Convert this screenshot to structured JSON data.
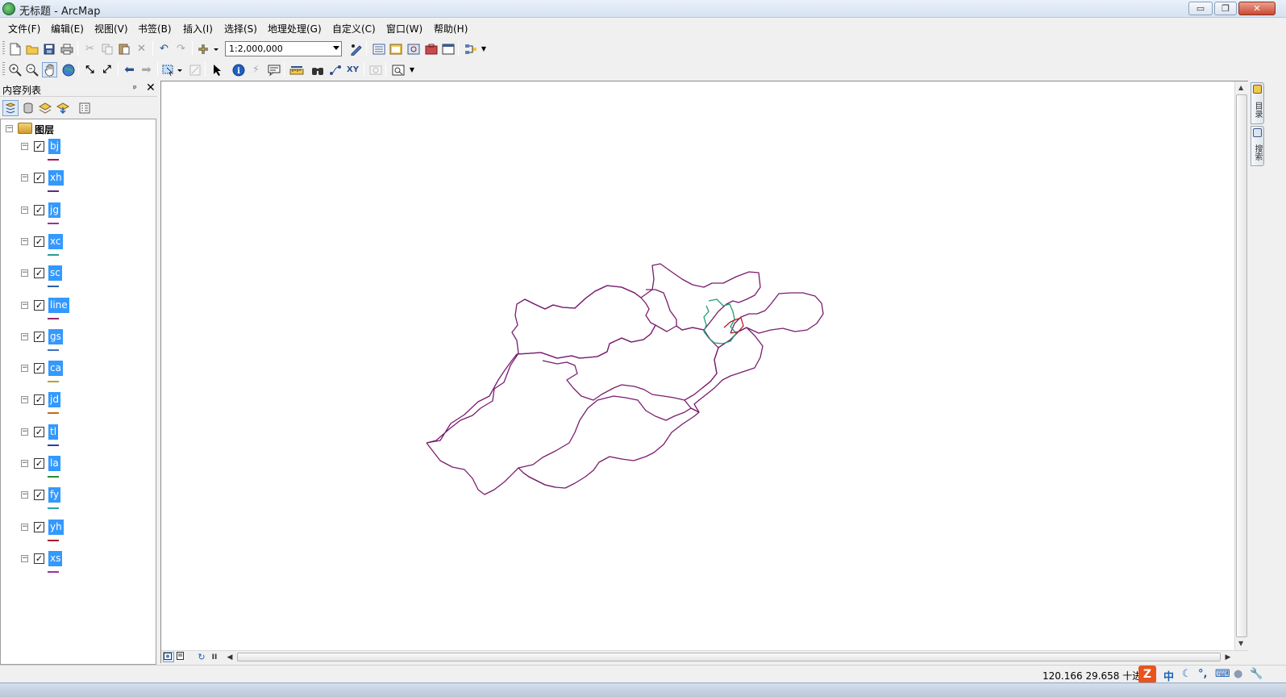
{
  "window": {
    "title": "无标题 - ArcMap",
    "minimize": "▭",
    "restore": "❐",
    "close": "✕"
  },
  "menu": [
    "文件(F)",
    "编辑(E)",
    "视图(V)",
    "书签(B)",
    "插入(I)",
    "选择(S)",
    "地理处理(G)",
    "自定义(C)",
    "窗口(W)",
    "帮助(H)"
  ],
  "toolbar": {
    "scale": "1:2,000,000"
  },
  "toc": {
    "title": "内容列表",
    "pin": "ᵖ",
    "close": "✕",
    "root_label": "图层",
    "layers": [
      {
        "name": "bj",
        "color": "#a0195a"
      },
      {
        "name": "xh",
        "color": "#5a2a8c"
      },
      {
        "name": "jg",
        "color": "#9b2fa8"
      },
      {
        "name": "xc",
        "color": "#2a9d8f"
      },
      {
        "name": "sc",
        "color": "#2b5fa8"
      },
      {
        "name": "line",
        "color": "#8e2b6b"
      },
      {
        "name": "gs",
        "color": "#3d6fbf"
      },
      {
        "name": "ca",
        "color": "#b8a12a"
      },
      {
        "name": "jd",
        "color": "#c46a1b"
      },
      {
        "name": "tl",
        "color": "#2b3fa8"
      },
      {
        "name": "la",
        "color": "#2e8b3a"
      },
      {
        "name": "fy",
        "color": "#2aa0b8"
      },
      {
        "name": "yh",
        "color": "#a81b2b"
      },
      {
        "name": "xs",
        "color": "#9b2fa8"
      }
    ]
  },
  "map": {
    "outline_color": "#7a1c6e",
    "highlight_green": "#1f9e73",
    "highlight_red": "#b81c1c"
  },
  "side_tabs": [
    "目录",
    "搜索"
  ],
  "status": {
    "coords": "120.166  29.658 十进",
    "ime_logo": "Z",
    "ime_lang": "中"
  }
}
